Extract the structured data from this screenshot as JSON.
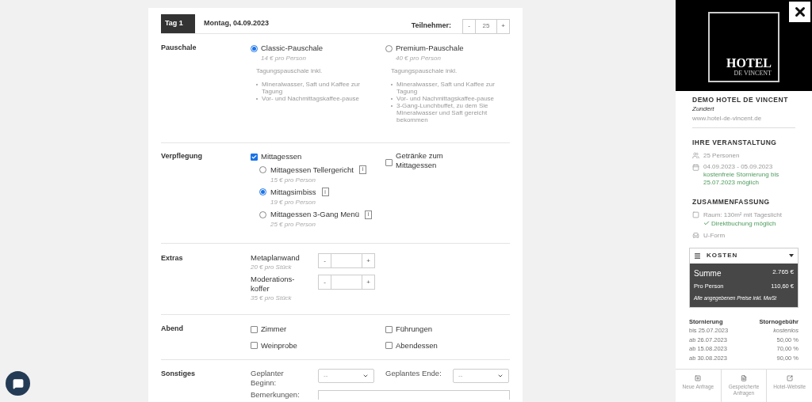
{
  "day": {
    "tab": "Tag 1",
    "date": "Montag, 04.09.2023"
  },
  "participants": {
    "label": "Teilnehmer:",
    "minus": "-",
    "value": "25",
    "plus": "+"
  },
  "sections": [
    {
      "kind": "package",
      "label": "Pauschale",
      "options": [
        {
          "name": "Classic-Pauschale",
          "price": "14 € pro Person",
          "intro": "Tagungspauschale inkl.",
          "items": [
            "Mineralwasser, Saft und Kaffee zur Tagung",
            "Vor- und Nachmittagskaffee-pause"
          ],
          "selected": true
        },
        {
          "name": "Premium-Pauschale",
          "price": "40 € pro Person",
          "intro": "Tagungspauschale inkl.",
          "items": [
            "Mineralwasser, Saft und Kaffee zur Tagung",
            "Vor- und Nachmittagskaffee-pause",
            "3-Gang-Lunchbuffet, zu dem Sie Mineralwasser und Saft gereicht bekommen"
          ],
          "selected": false
        }
      ]
    },
    {
      "kind": "catering",
      "label": "Verpflegung",
      "main": {
        "name": "Mittagessen",
        "checked": true,
        "choices": [
          {
            "name": "Mittagessen Tellergericht",
            "price": "15 € pro Person",
            "info": "i",
            "selected": false
          },
          {
            "name": "Mittagsimbiss",
            "price": "19 € pro Person",
            "info": "i",
            "selected": true
          },
          {
            "name": "Mittagessen 3-Gang Menü",
            "price": "25 € pro Person",
            "info": "i",
            "selected": false
          }
        ]
      },
      "other": {
        "name": "Getränke zum Mittagessen",
        "checked": false
      }
    },
    {
      "kind": "extras",
      "label": "Extras",
      "items": [
        {
          "name": "Metaplanwand",
          "price": "20 € pro Stück",
          "minus": "-",
          "plus": "+"
        },
        {
          "name": "Moderations-koffer",
          "price": "35 € pro Stück",
          "minus": "-",
          "plus": "+"
        }
      ]
    },
    {
      "kind": "checks",
      "label": "Abend",
      "items": [
        {
          "name": "Zimmer",
          "checked": false
        },
        {
          "name": "Führungen",
          "checked": false
        },
        {
          "name": "Weinprobe",
          "checked": false
        },
        {
          "name": "Abendessen",
          "checked": false
        }
      ]
    },
    {
      "kind": "misc",
      "label": "Sonstiges",
      "start": {
        "label": "Geplanter Beginn:",
        "value": "--"
      },
      "end": {
        "label": "Geplantes Ende:",
        "value": "--"
      },
      "remarks": {
        "label": "Bemerkungen:"
      }
    }
  ],
  "hotel": {
    "logo_title": "HOTEL",
    "logo_subtitle": "DE VINCENT",
    "name": "DEMO HOTEL DE VINCENT",
    "city": "Zundert",
    "website": "www.hotel-de-vincent.de"
  },
  "event": {
    "heading": "IHRE VERANSTALTUNG",
    "persons": "25 Personen",
    "dates": "04.09.2023 - 05.09.2023",
    "note": "kostenfreie Stornierung bis 25.07.2023 möglich"
  },
  "summary": {
    "heading": "ZUSAMMENFASSUNG",
    "room": "Raum: 130m² mit Tageslicht",
    "direct": "Direktbuchung möglich",
    "layout": "U-Form"
  },
  "costs": {
    "heading": "KOSTEN",
    "expanded": true,
    "total_label": "Summe",
    "total": "2.765 €",
    "per_person_label": "Pro Person",
    "per_person": "110,60 €",
    "note": "Alle angegebenen Preise inkl. MwSt"
  },
  "cancellation": {
    "columns": [
      "Stornierung",
      "Stornogebühr"
    ],
    "rows": [
      {
        "date": "bis 25.07.2023",
        "fee": "kostenlos",
        "kind": "free"
      },
      {
        "date": "ab 26.07.2023",
        "fee": "50,00 %",
        "kind": "percent"
      },
      {
        "date": "ab 15.08.2023",
        "fee": "70,00 %",
        "kind": "percent"
      },
      {
        "date": "ab 30.08.2023",
        "fee": "90,00 %",
        "kind": "percent"
      }
    ]
  },
  "footer_buttons": [
    {
      "label": "Neue Anfrage",
      "kind": "new"
    },
    {
      "label": "Gespeicherte Anfragen",
      "kind": "saved"
    },
    {
      "label": "Hotel-Website",
      "kind": "web"
    }
  ]
}
